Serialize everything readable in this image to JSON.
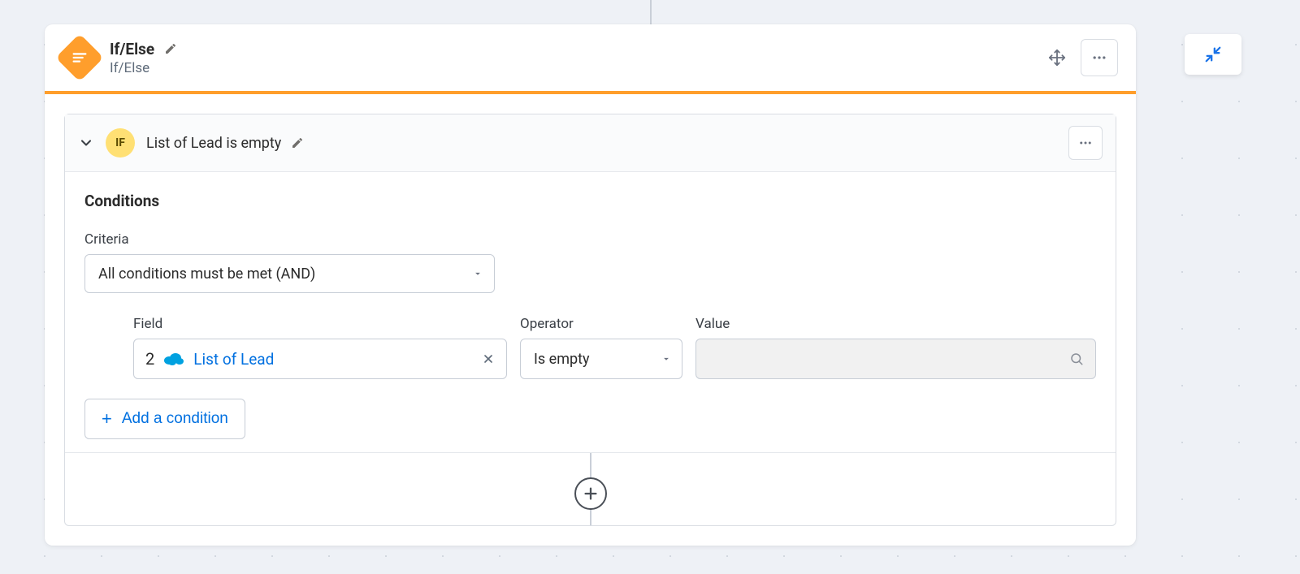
{
  "header": {
    "title": "If/Else",
    "subtitle": "If/Else"
  },
  "condition": {
    "badge": "IF",
    "title": "List of Lead is empty",
    "section_label": "Conditions",
    "criteria_label": "Criteria",
    "criteria_value": "All conditions must be met (AND)",
    "columns": {
      "field": "Field",
      "operator": "Operator",
      "value": "Value"
    },
    "row": {
      "index": "2",
      "field_text": "List of Lead",
      "operator": "Is empty",
      "value": ""
    },
    "add_label": "Add a condition"
  }
}
